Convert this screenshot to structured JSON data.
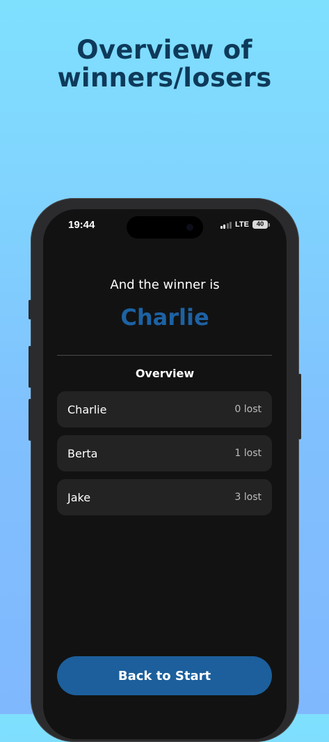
{
  "headline": {
    "line1": "Overview of",
    "line2": "winners/losers"
  },
  "status_bar": {
    "time": "19:44",
    "network": "LTE",
    "battery": "40"
  },
  "result": {
    "intro": "And the winner is",
    "winner": "Charlie"
  },
  "overview": {
    "heading": "Overview",
    "players": [
      {
        "name": "Charlie",
        "lost": "0 lost"
      },
      {
        "name": "Berta",
        "lost": "1 lost"
      },
      {
        "name": "Jake",
        "lost": "3 lost"
      }
    ]
  },
  "actions": {
    "back_label": "Back to Start"
  },
  "colors": {
    "winner_accent": "#1d62a3",
    "button": "#1c5f9c",
    "headline": "#0e3a5a"
  }
}
